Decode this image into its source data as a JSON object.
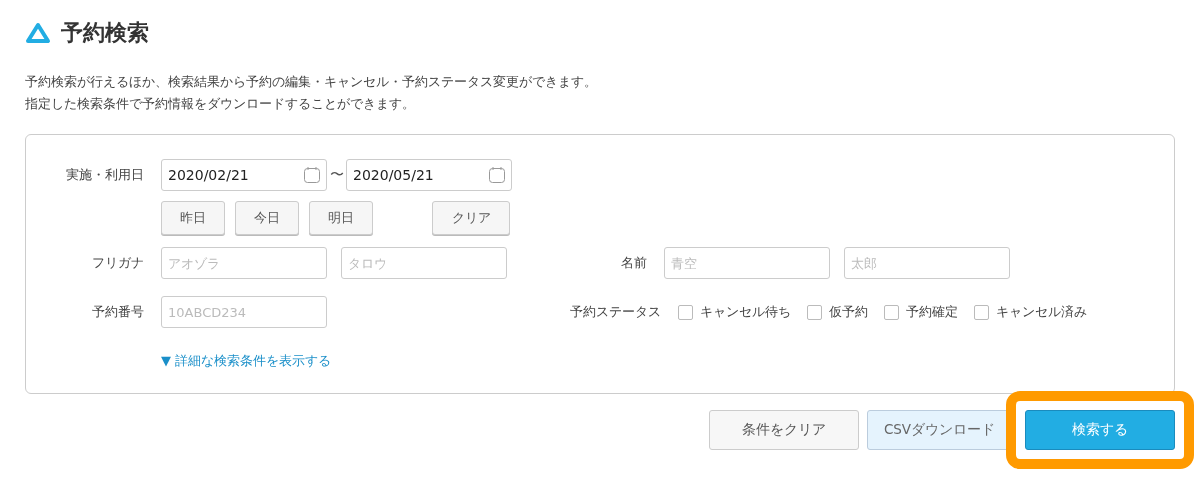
{
  "page": {
    "title": "予約検索",
    "description": [
      "予約検索が行えるほか、検索結果から予約の編集・キャンセル・予約ステータス変更ができます。",
      "指定した検索条件で予約情報をダウンロードすることができます。"
    ]
  },
  "form": {
    "date": {
      "label": "実施・利用日",
      "from": "2020/02/21",
      "separator": "〜",
      "to": "2020/05/21"
    },
    "quick_buttons": [
      "昨日",
      "今日",
      "明日"
    ],
    "clear_dates_button": "クリア",
    "furigana": {
      "label": "フリガナ",
      "placeholders": [
        "アオゾラ",
        "タロウ"
      ]
    },
    "name": {
      "label": "名前",
      "placeholders": [
        "青空",
        "太郎"
      ]
    },
    "reservation_number": {
      "label": "予約番号",
      "placeholder": "10ABCD234"
    },
    "status": {
      "label": "予約ステータス",
      "options": [
        {
          "label": "キャンセル待ち",
          "checked": false
        },
        {
          "label": "仮予約",
          "checked": false
        },
        {
          "label": "予約確定",
          "checked": false
        },
        {
          "label": "キャンセル済み",
          "checked": false
        }
      ]
    },
    "advanced_link": {
      "icon": "▼",
      "label": "詳細な検索条件を表示する"
    }
  },
  "actions": [
    {
      "kind": "plain",
      "label": "条件をクリア",
      "highlighted": false
    },
    {
      "kind": "light",
      "label": "CSVダウンロード",
      "highlighted": false
    },
    {
      "kind": "primary",
      "label": "検索する",
      "highlighted": true
    }
  ]
}
